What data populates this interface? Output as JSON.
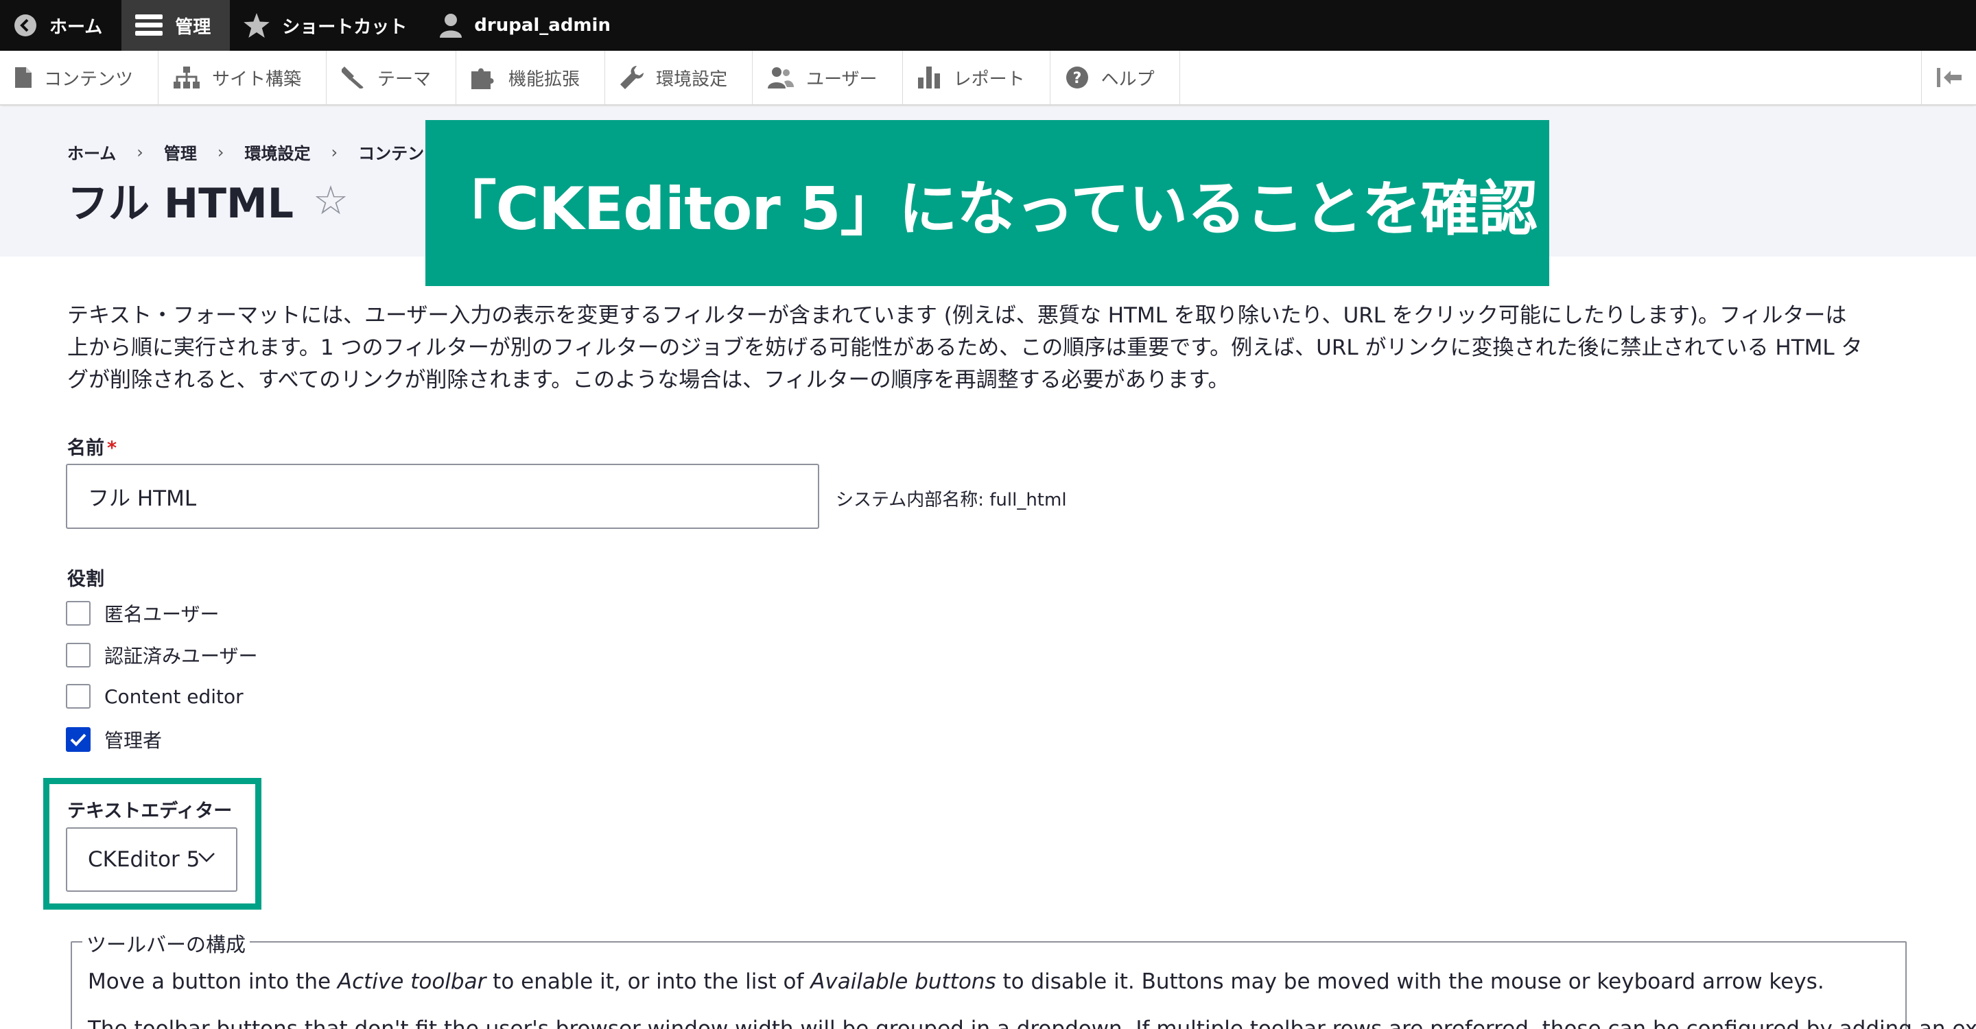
{
  "topbar": {
    "home": "ホーム",
    "manage": "管理",
    "shortcuts": "ショートカット",
    "user": "drupal_admin"
  },
  "tray": {
    "items": [
      "コンテンツ",
      "サイト構築",
      "テーマ",
      "機能拡張",
      "環境設定",
      "ユーザー",
      "レポート",
      "ヘルプ"
    ]
  },
  "breadcrumb": [
    "ホーム",
    "管理",
    "環境設定",
    "コンテン"
  ],
  "page_title": "フル HTML",
  "banner": "「CKEditor 5」になっていることを確認",
  "description": {
    "line1": "テキスト・フォーマットには、ユーザー入力の表示を変更するフィルターが含まれています (例えば、悪質な HTML を取り除いたり、URL をクリック可能にしたりします)。フィルターは",
    "line2": "上から順に実行されます。1 つのフィルターが別のフィルターのジョブを妨げる可能性があるため、この順序は重要です。例えば、URL がリンクに変換された後に禁止されている HTML タ",
    "line3": "グが削除されると、すべてのリンクが削除されます。このような場合は、フィルターの順序を再調整する必要があります。"
  },
  "name_field": {
    "label": "名前",
    "required_mark": "*",
    "value": "フル HTML",
    "machine_name": "システム内部名称: full_html"
  },
  "roles": {
    "label": "役割",
    "items": [
      {
        "label": "匿名ユーザー",
        "checked": false
      },
      {
        "label": "認証済みユーザー",
        "checked": false
      },
      {
        "label": "Content editor",
        "checked": false
      },
      {
        "label": "管理者",
        "checked": true
      }
    ]
  },
  "editor": {
    "label": "テキストエディター",
    "value": "CKEditor 5"
  },
  "toolbar_config": {
    "legend": "ツールバーの構成",
    "text_before_active": "Move a button into the ",
    "active": "Active toolbar",
    "text_middle": " to enable it, or into the list of ",
    "available": "Available buttons",
    "text_after": " to disable it. Buttons may be moved with the mouse or keyboard arrow keys.",
    "text_line2": "The toolbar buttons that don't fit the user's browser window width will be grouped in a dropdown. If multiple toolbar rows are preferred, those can be configured by adding an explicit"
  },
  "colors": {
    "accent_green": "#00a287",
    "checkbox_blue": "#003ecc",
    "required_red": "#d72222"
  }
}
